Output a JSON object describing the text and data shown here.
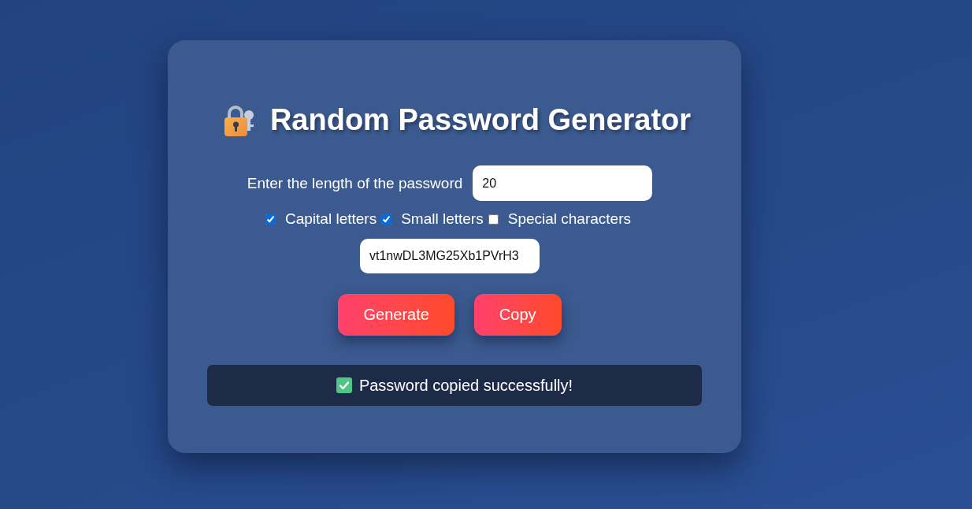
{
  "title": "Random Password Generator",
  "length_field": {
    "label": "Enter the length of the password",
    "value": "20"
  },
  "options": [
    {
      "label": "Capital letters",
      "checked": true
    },
    {
      "label": "Small letters",
      "checked": true
    },
    {
      "label": "Special characters",
      "checked": false
    }
  ],
  "password_field": {
    "value": "vt1nwDL3MG25Xb1PVrH3"
  },
  "buttons": [
    "Generate",
    "Copy"
  ],
  "status": {
    "text": "Password copied successfully!"
  }
}
